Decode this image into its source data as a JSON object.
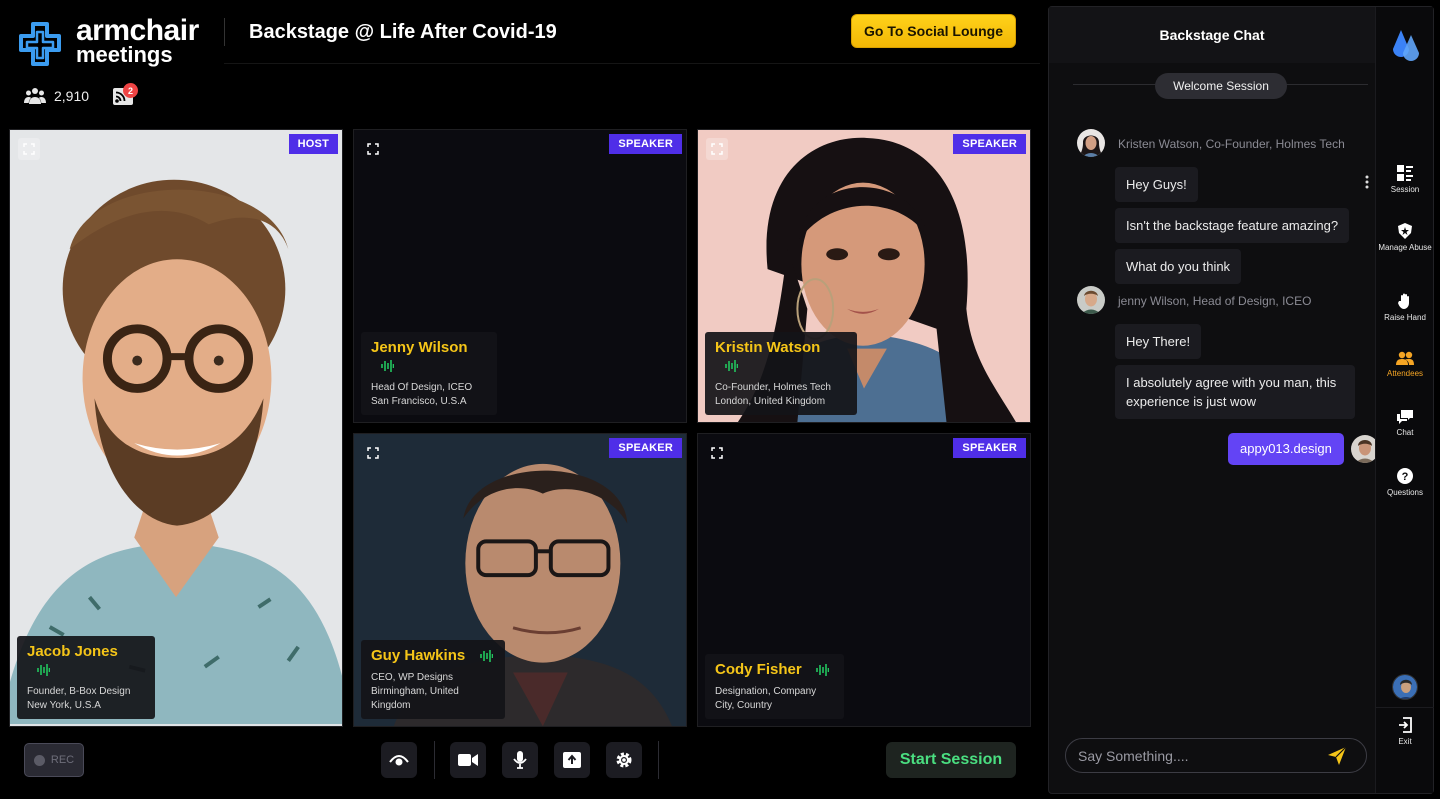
{
  "header": {
    "brand_line1": "armchair",
    "brand_line2": "meetings",
    "event_title": "Backstage @ Life After Covid-19",
    "lounge_button": "Go To Social Lounge",
    "attendee_count": "2,910",
    "cast_badge": "2"
  },
  "tiles": [
    {
      "role": "HOST",
      "name": "Jacob Jones",
      "line1": "Founder, B-Box Design",
      "line2": "New York, U.S.A"
    },
    {
      "role": "SPEAKER",
      "name": "Jenny Wilson",
      "line1": "Head Of Design, ICEO",
      "line2": "San Francisco, U.S.A"
    },
    {
      "role": "SPEAKER",
      "name": "Kristin Watson",
      "line1": "Co-Founder, Holmes Tech",
      "line2": "London, United Kingdom"
    },
    {
      "role": "SPEAKER",
      "name": "Guy Hawkins",
      "line1": "CEO, WP Designs",
      "line2": "Birmingham, United Kingdom"
    },
    {
      "role": "SPEAKER",
      "name": "Cody Fisher",
      "line1": "Designation, Company",
      "line2": "City, Country"
    }
  ],
  "controls": {
    "rec_label": "REC",
    "start_session": "Start Session"
  },
  "chat": {
    "title": "Backstage Chat",
    "session_pill": "Welcome Session",
    "groups": [
      {
        "sender": "Kristen Watson, Co-Founder, Holmes Tech",
        "messages": [
          "Hey Guys!",
          "Isn't the backstage feature amazing?",
          "What do you think"
        ]
      },
      {
        "sender": "jenny Wilson, Head of Design, ICEO",
        "messages": [
          "Hey There!",
          "I absolutely agree with you man, this experience is just wow"
        ]
      }
    ],
    "my_message": "appy013.design",
    "input_placeholder": "Say Something...."
  },
  "rail": {
    "items": [
      {
        "label": "Session",
        "icon": "session-icon"
      },
      {
        "label": "Manage Abuse",
        "icon": "shield-icon"
      },
      {
        "label": "Raise Hand",
        "icon": "hand-icon"
      },
      {
        "label": "Attendees",
        "icon": "attendees-icon",
        "active": true
      },
      {
        "label": "Chat",
        "icon": "chat-icon"
      },
      {
        "label": "Questions",
        "icon": "question-icon"
      }
    ],
    "exit_label": "Exit"
  },
  "colors": {
    "accent_yellow": "#f5c518",
    "badge_purple": "#4f2ee8",
    "my_bubble": "#6344f5",
    "start_green": "#4ade80",
    "active_orange": "#f5a524"
  }
}
